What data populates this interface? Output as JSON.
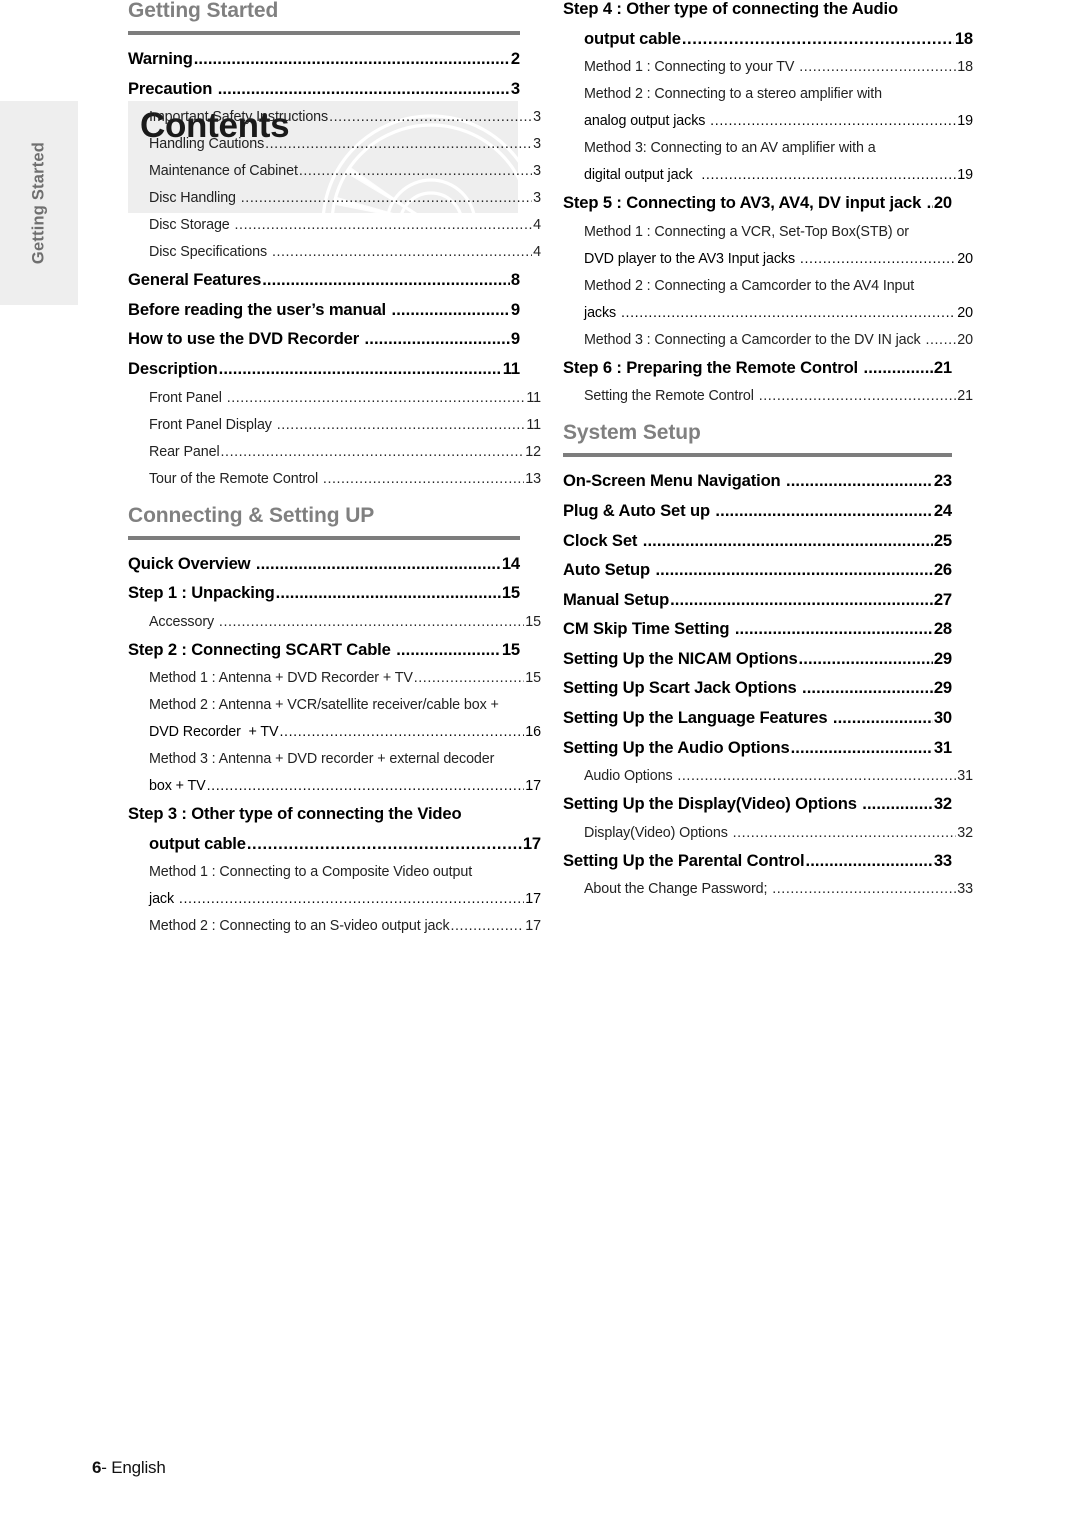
{
  "side_tab": {
    "label": "Getting Started"
  },
  "header": {
    "title": "Contents",
    "disc_art_icon": "dvd-disc-icon"
  },
  "footer": {
    "page_number": "6",
    "separator": "- ",
    "language": "English"
  },
  "colors": {
    "band_gray": "#eeeeee",
    "rule_gray": "#7d7d7d",
    "section_head_gray": "#808080"
  },
  "sections": [
    {
      "id": "getting-started",
      "column": "left",
      "title": "Getting Started",
      "entries": [
        {
          "level": 1,
          "label": "Warning",
          "page": "2"
        },
        {
          "level": 1,
          "label": "Precaution ",
          "page": "3"
        },
        {
          "level": 2,
          "label": "Important Safety Instructions",
          "page": "3"
        },
        {
          "level": 2,
          "label": "Handling Cautions",
          "page": "3"
        },
        {
          "level": 2,
          "label": "Maintenance of Cabinet",
          "page": "3"
        },
        {
          "level": 2,
          "label": "Disc Handling ",
          "page": "3"
        },
        {
          "level": 2,
          "label": "Disc Storage ",
          "page": "4"
        },
        {
          "level": 2,
          "label": "Disc Specifications ",
          "page": "4"
        },
        {
          "level": 1,
          "label": "General Features",
          "page": "8"
        },
        {
          "level": 1,
          "label": "Before reading the user’s manual ",
          "page": "9"
        },
        {
          "level": 1,
          "label": "How to use the DVD Recorder ",
          "page": "9"
        },
        {
          "level": 1,
          "label": "Description",
          "page": "11"
        },
        {
          "level": 2,
          "label": "Front Panel ",
          "page": "11"
        },
        {
          "level": 2,
          "label": "Front Panel Display ",
          "page": "11"
        },
        {
          "level": 2,
          "label": "Rear Panel",
          "page": "12"
        },
        {
          "level": 2,
          "label": "Tour of the Remote Control ",
          "page": "13"
        }
      ]
    },
    {
      "id": "connecting-setting-up",
      "column": "left",
      "title": "Connecting & Setting UP",
      "entries": [
        {
          "level": 1,
          "label": "Quick Overview ",
          "page": "14"
        },
        {
          "level": 1,
          "label": "Step 1 : Unpacking",
          "page": "15"
        },
        {
          "level": 2,
          "label": "Accessory ",
          "page": "15"
        },
        {
          "level": 1,
          "label": "Step 2 : Connecting SCART Cable ",
          "page": "15"
        },
        {
          "level": 2,
          "label": "Method 1 : Antenna + DVD Recorder + TV",
          "page": "15"
        },
        {
          "level": 2,
          "label": "Method 2 : Antenna + VCR/satellite receiver/cable box +",
          "wrap_head": true
        },
        {
          "level": 2,
          "label": "DVD Recorder  + TV",
          "page": "16",
          "continuation": true
        },
        {
          "level": 2,
          "label": "Method 3 : Antenna + DVD recorder + external decoder",
          "wrap_head": true
        },
        {
          "level": 2,
          "label": "box + TV",
          "page": "17",
          "continuation": true
        },
        {
          "level": 1,
          "label": "Step 3 : Other type of connecting the Video",
          "wrap_head": true
        },
        {
          "level": 1,
          "label": "output cable",
          "page": "17",
          "continuation": true
        },
        {
          "level": 2,
          "label": "Method 1 : Connecting to a Composite Video output",
          "wrap_head": true
        },
        {
          "level": 2,
          "label": "jack ",
          "page": "17",
          "continuation": true
        },
        {
          "level": 2,
          "label": "Method 2 : Connecting to an S-video output jack",
          "page": "17"
        }
      ]
    },
    {
      "id": "connecting-setting-up-right",
      "column": "right",
      "title": null,
      "entries": [
        {
          "level": 1,
          "label": "Step 4 : Other type of connecting the Audio",
          "wrap_head": true
        },
        {
          "level": 1,
          "label": "output cable",
          "page": "18",
          "continuation": true
        },
        {
          "level": 2,
          "label": "Method 1 : Connecting to your TV ",
          "page": "18"
        },
        {
          "level": 2,
          "label": "Method 2 : Connecting to a stereo amplifier with",
          "wrap_head": true
        },
        {
          "level": 2,
          "label": "analog output jacks ",
          "page": "19",
          "continuation": true
        },
        {
          "level": 2,
          "label": "Method 3: Connecting to an AV amplifier with a",
          "wrap_head": true
        },
        {
          "level": 2,
          "label": "digital output jack  ",
          "page": "19",
          "continuation": true
        },
        {
          "level": 1,
          "label": "Step 5 : Connecting to AV3, AV4, DV input jack ",
          "page": "20"
        },
        {
          "level": 2,
          "label": "Method 1 : Connecting a VCR, Set-Top Box(STB) or",
          "wrap_head": true
        },
        {
          "level": 2,
          "label": "DVD player to the AV3 Input jacks ",
          "page": "20",
          "continuation": true
        },
        {
          "level": 2,
          "label": "Method 2 : Connecting a Camcorder to the AV4 Input",
          "wrap_head": true
        },
        {
          "level": 2,
          "label": "jacks ",
          "page": "20",
          "continuation": true
        },
        {
          "level": 2,
          "label": "Method 3 : Connecting a Camcorder to the DV IN jack ",
          "page": "20"
        },
        {
          "level": 1,
          "label": "Step 6 : Preparing the Remote Control ",
          "page": "21"
        },
        {
          "level": 2,
          "label": "Setting the Remote Control ",
          "page": "21"
        }
      ]
    },
    {
      "id": "system-setup",
      "column": "right",
      "title": "System Setup",
      "entries": [
        {
          "level": 1,
          "label": "On-Screen Menu Navigation ",
          "page": "23"
        },
        {
          "level": 1,
          "label": "Plug & Auto Set up ",
          "page": "24"
        },
        {
          "level": 1,
          "label": "Clock Set ",
          "page": "25"
        },
        {
          "level": 1,
          "label": "Auto Setup ",
          "page": "26"
        },
        {
          "level": 1,
          "label": "Manual Setup",
          "page": "27"
        },
        {
          "level": 1,
          "label": "CM Skip Time Setting ",
          "page": "28"
        },
        {
          "level": 1,
          "label": "Setting Up the NICAM Options",
          "page": "29"
        },
        {
          "level": 1,
          "label": "Setting Up Scart Jack Options ",
          "page": "29"
        },
        {
          "level": 1,
          "label": "Setting Up the Language Features ",
          "page": "30"
        },
        {
          "level": 1,
          "label": "Setting Up the Audio Options",
          "page": "31"
        },
        {
          "level": 2,
          "label": "Audio Options ",
          "page": "31"
        },
        {
          "level": 1,
          "label": "Setting Up the Display(Video) Options ",
          "page": "32"
        },
        {
          "level": 2,
          "label": "Display(Video) Options ",
          "page": "32"
        },
        {
          "level": 1,
          "label": "Setting Up the Parental Control",
          "page": "33"
        },
        {
          "level": 2,
          "label": "About the Change Password; ",
          "page": "33"
        }
      ]
    }
  ]
}
